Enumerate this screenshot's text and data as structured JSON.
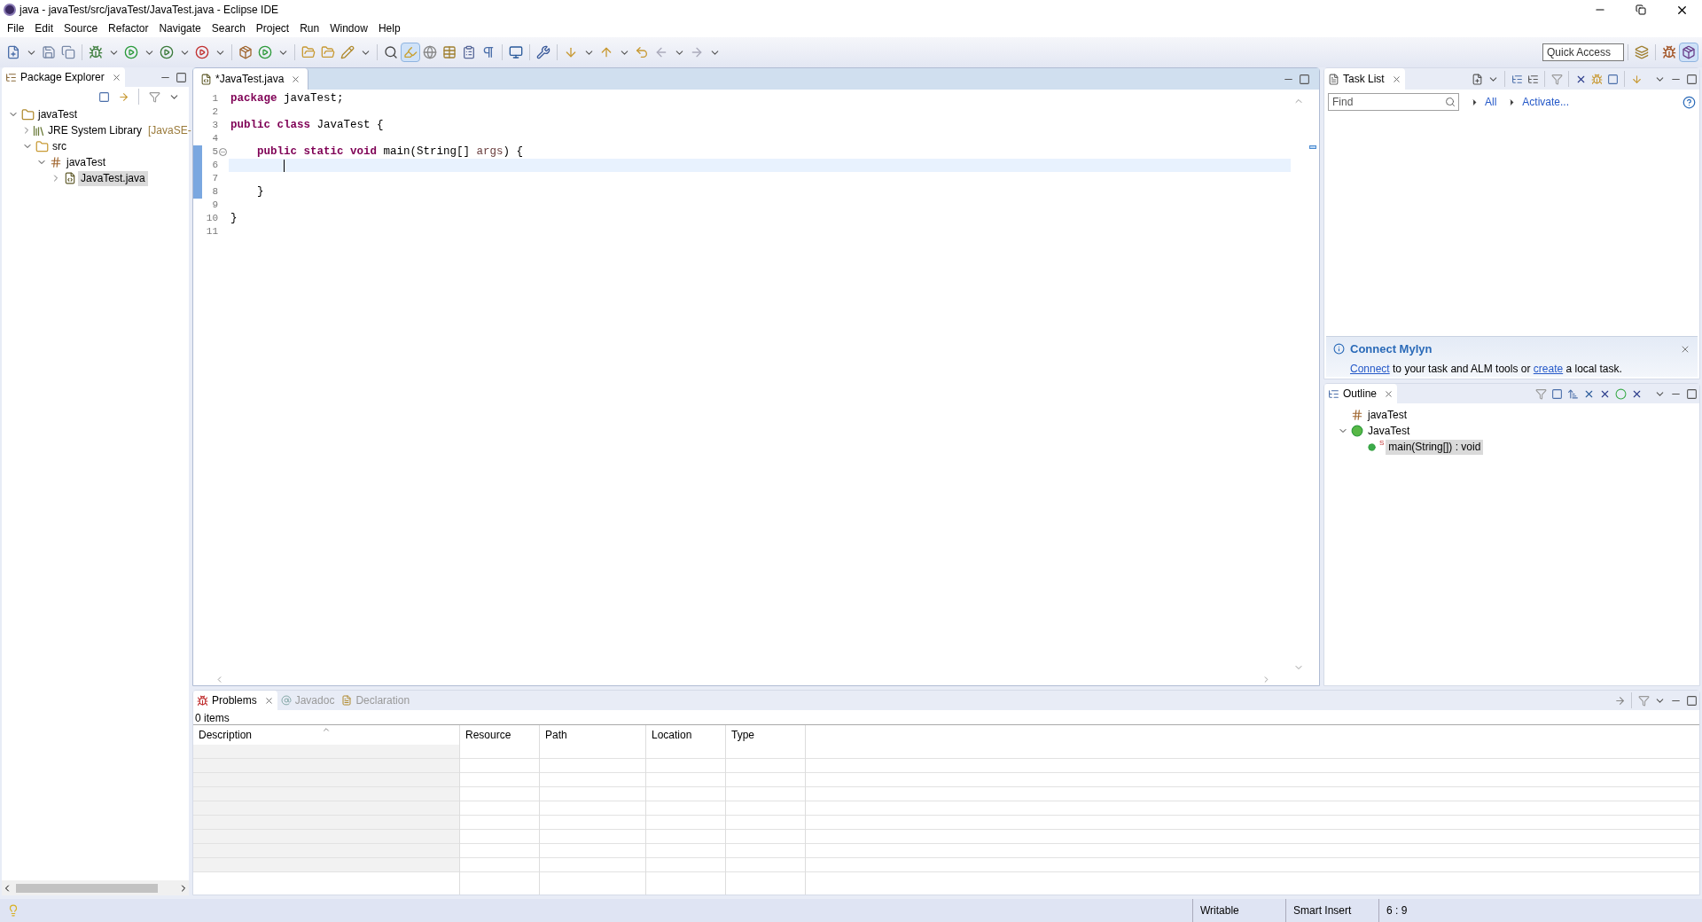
{
  "window": {
    "title": "java - javaTest/src/javaTest/JavaTest.java - Eclipse IDE"
  },
  "menu": [
    "File",
    "Edit",
    "Source",
    "Refactor",
    "Navigate",
    "Search",
    "Project",
    "Run",
    "Window",
    "Help"
  ],
  "quick_access": {
    "placeholder": "Quick Access"
  },
  "package_explorer": {
    "title": "Package Explorer",
    "tree": [
      {
        "label": "javaTest",
        "kind": "project",
        "expanded": true,
        "selected": false,
        "children": [
          {
            "label": "JRE System Library",
            "decoration": "[JavaSE-",
            "kind": "library",
            "expanded": false,
            "selected": false
          },
          {
            "label": "src",
            "kind": "folder",
            "expanded": true,
            "selected": false,
            "children": [
              {
                "label": "javaTest",
                "kind": "package",
                "expanded": true,
                "selected": false,
                "children": [
                  {
                    "label": "JavaTest.java",
                    "kind": "file",
                    "expanded": false,
                    "selected": true
                  }
                ]
              }
            ]
          }
        ]
      }
    ]
  },
  "editor": {
    "tab": "*JavaTest.java",
    "lines": [
      {
        "number": "1",
        "tokens": [
          {
            "kind": "keyword",
            "text": "package"
          },
          {
            "kind": "plain",
            "text": " javaTest;"
          }
        ]
      },
      {
        "number": "2"
      },
      {
        "number": "3",
        "tokens": [
          {
            "kind": "keyword",
            "text": "public class"
          },
          {
            "kind": "plain",
            "text": " JavaTest {"
          }
        ]
      },
      {
        "number": "4"
      },
      {
        "number": "5",
        "changed": true,
        "fold": true,
        "tokens": [
          {
            "kind": "keyword",
            "text": "    public static void"
          },
          {
            "kind": "plain",
            "text": " main(String[] "
          },
          {
            "kind": "param",
            "text": "args"
          },
          {
            "kind": "plain",
            "text": ") {"
          }
        ]
      },
      {
        "number": "6",
        "current": true,
        "changed": true
      },
      {
        "number": "7",
        "changed": true
      },
      {
        "number": "8",
        "changed": true,
        "tokens": [
          {
            "kind": "plain",
            "text": "    }"
          }
        ]
      },
      {
        "number": "9"
      },
      {
        "number": "10",
        "tokens": [
          {
            "kind": "plain",
            "text": "}"
          }
        ]
      },
      {
        "number": "11"
      }
    ]
  },
  "task_list": {
    "title": "Task List",
    "find": {
      "placeholder": "Find"
    },
    "links": [
      "All",
      "Activate..."
    ],
    "connect": {
      "title": "Connect Mylyn",
      "parts": [
        {
          "kind": "link",
          "text": "Connect"
        },
        {
          "kind": "text",
          "text": " to your task and ALM tools or "
        },
        {
          "kind": "link",
          "text": "create"
        },
        {
          "kind": "text",
          "text": " a local task."
        }
      ]
    }
  },
  "outline": {
    "title": "Outline",
    "tree": [
      {
        "label": "javaTest",
        "kind": "package",
        "selected": false
      },
      {
        "label": "JavaTest",
        "kind": "class",
        "expanded": true,
        "selected": false,
        "children": [
          {
            "label": "main(String[]) : void",
            "kind": "method",
            "badge": "S",
            "selected": true
          }
        ]
      }
    ]
  },
  "bottom_tabs": [
    {
      "label": "Problems",
      "selected": true
    },
    {
      "label": "Javadoc",
      "selected": false
    },
    {
      "label": "Declaration",
      "selected": false
    }
  ],
  "problems": {
    "summary": "0 items",
    "columns": [
      "Description",
      "Resource",
      "Path",
      "Location",
      "Type"
    ]
  },
  "status_bar": [
    "Writable",
    "Smart Insert",
    "6 : 9"
  ]
}
